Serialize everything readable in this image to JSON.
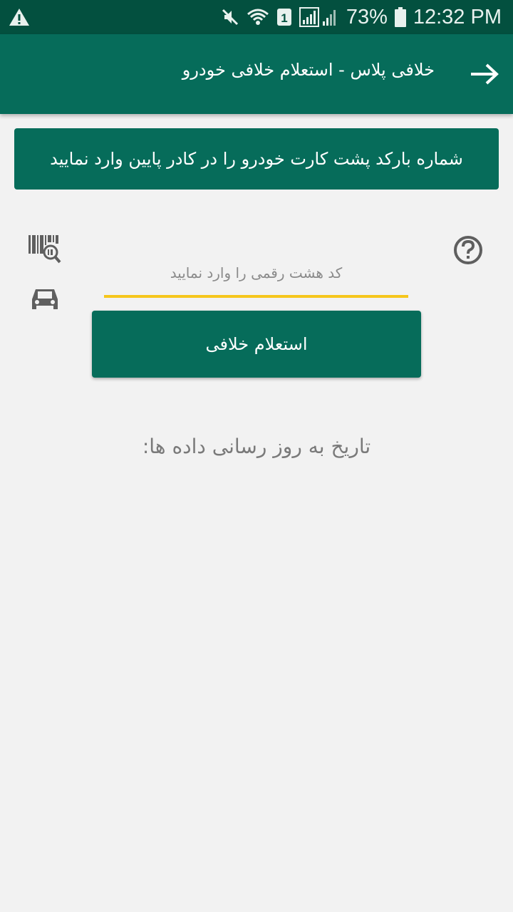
{
  "status_bar": {
    "battery": "73%",
    "time": "12:32 PM",
    "sim_slot": "1"
  },
  "app_bar": {
    "title": "خلافی پلاس - استعلام خلافی خودرو"
  },
  "banner": {
    "text": "شماره بارکد پشت کارت خودرو را در کادر پایین وارد نمایید"
  },
  "form": {
    "code_placeholder": "کد هشت رقمی را وارد نمایید",
    "code_value": "",
    "submit_label": "استعلام خلافی"
  },
  "info": {
    "update_date_label": "تاریخ به روز رسانی داده ها:"
  },
  "colors": {
    "primary": "#066c5a",
    "status_bar": "#03503f",
    "accent_underline": "#f6c61c",
    "background": "#f2f2f2",
    "icon_gray": "#5f5f5f"
  },
  "icons": [
    "warning-icon",
    "mute-icon",
    "wifi-icon",
    "sim-icon",
    "signal-icon",
    "battery-icon",
    "back-arrow-icon",
    "barcode-scan-icon",
    "car-icon",
    "help-icon"
  ]
}
